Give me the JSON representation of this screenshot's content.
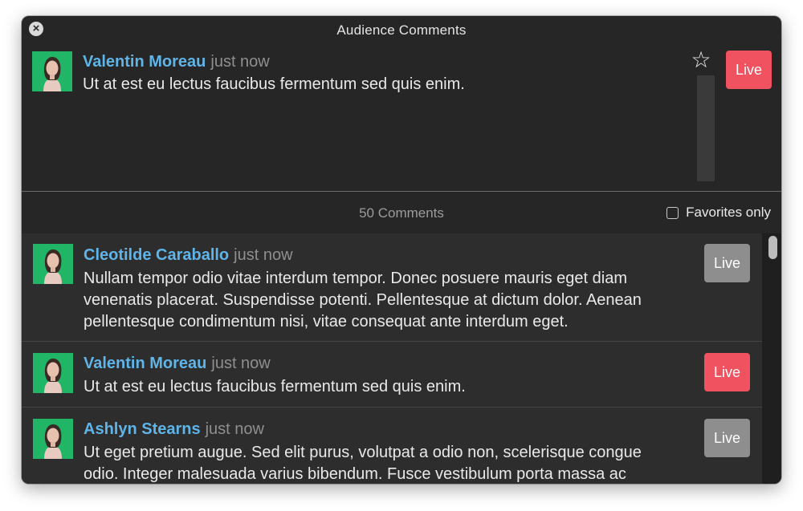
{
  "window": {
    "title": "Audience Comments"
  },
  "featured": {
    "name": "Valentin Moreau",
    "time": "just now",
    "text": "Ut at est eu lectus faucibus fermentum sed quis enim.",
    "live_label": "Live"
  },
  "status": {
    "count_label": "50 Comments",
    "favorites_label": "Favorites only",
    "favorites_checked": false
  },
  "comments": [
    {
      "name": "Cleotilde Caraballo",
      "time": "just now",
      "lines": [
        "Nullam tempor odio vitae interdum tempor. Donec posuere mauris eget diam",
        "venenatis placerat. Suspendisse potenti. Pellentesque at dictum dolor. Aenean",
        "pellentesque condimentum nisi, vitae consequat ante interdum eget."
      ],
      "live_label": "Live",
      "live_active": false
    },
    {
      "name": "Valentin Moreau",
      "time": "just now",
      "lines": [
        "Ut at est eu lectus faucibus fermentum sed quis enim."
      ],
      "live_label": "Live",
      "live_active": true
    },
    {
      "name": "Ashlyn Stearns",
      "time": "just now",
      "lines": [
        "Ut eget pretium augue. Sed elit purus, volutpat a odio non, scelerisque congue",
        "odio. Integer malesuada varius bibendum. Fusce vestibulum porta massa ac"
      ],
      "live_label": "Live",
      "live_active": false
    }
  ],
  "icons": {
    "close": "close-icon",
    "star": "star-icon",
    "avatar": "avatar-icon"
  },
  "colors": {
    "live_active": "#f0525f",
    "live_inactive": "#8e8e8e",
    "name": "#5fb4e8",
    "avatar_bg": "#20b567"
  }
}
